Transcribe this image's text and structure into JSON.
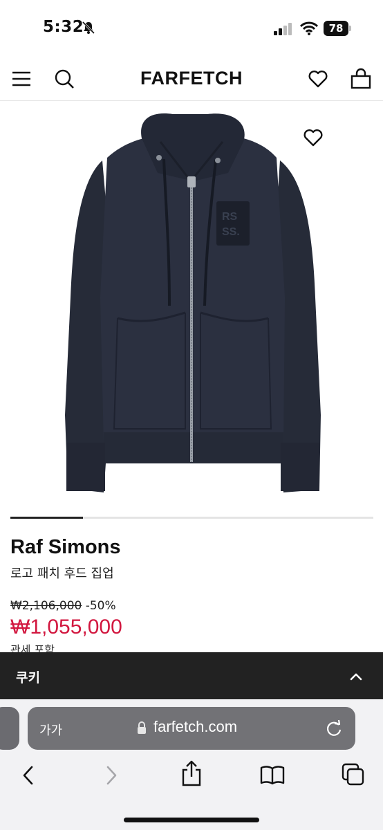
{
  "status_bar": {
    "time": "5:32",
    "battery": "78"
  },
  "header": {
    "logo": "FARFETCH",
    "icons": [
      "menu-icon",
      "search-icon",
      "heart-icon",
      "bag-icon"
    ]
  },
  "gallery": {
    "progress": 0.2,
    "wishlist_icon": "heart-outline-icon",
    "patch_text": "RS SS."
  },
  "product": {
    "brand": "Raf Simons",
    "name": "로고 패치 후드 집업",
    "original_price": "₩2,106,000",
    "discount": "-50%",
    "sale_price": "₩1,055,000",
    "tax_note": "관세 포함"
  },
  "cookie_bar": {
    "label": "쿠키",
    "icon": "chevron-up-icon"
  },
  "safari": {
    "text_size_label": "가가",
    "domain": "farfetch.com",
    "icons": [
      "lock-icon",
      "reload-icon",
      "back-icon",
      "forward-icon",
      "share-icon",
      "bookmarks-icon",
      "tabs-icon"
    ]
  },
  "colors": {
    "sale": "#d2173f",
    "cookie_bg": "#222222",
    "hoodie": "#2a2f3d"
  }
}
